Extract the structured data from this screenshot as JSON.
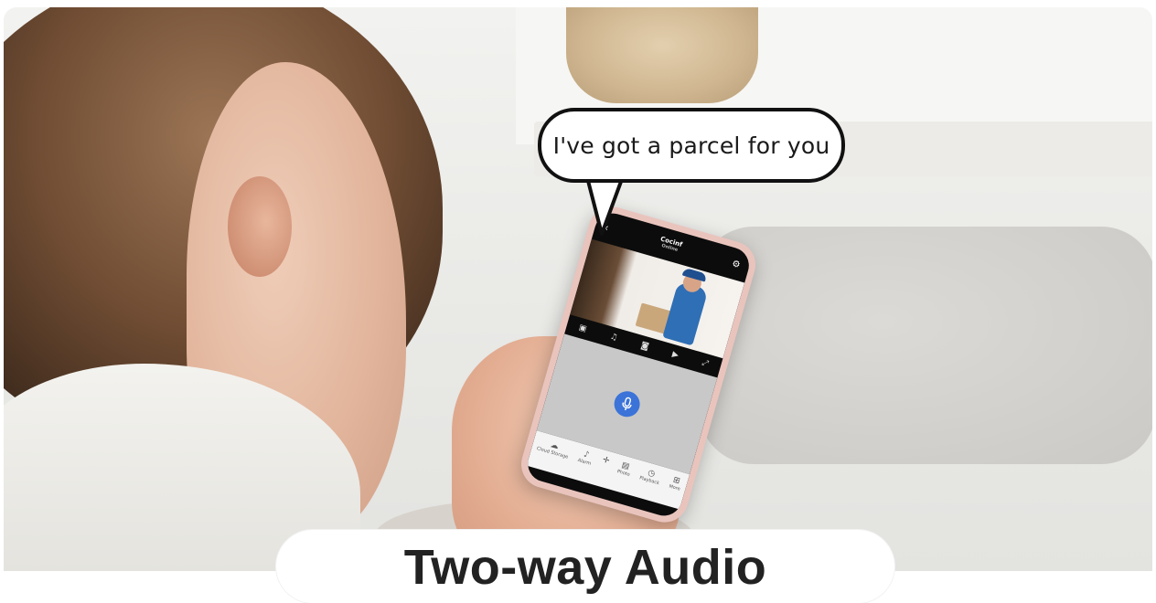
{
  "speech_bubble": {
    "text": "I've got a parcel for you"
  },
  "caption": {
    "title": "Two-way Audio"
  },
  "phone_app": {
    "header": {
      "title": "Cocinf",
      "subtitle": "Online",
      "back_icon": "back-arrow-icon",
      "settings_icon": "gear-icon"
    },
    "controls": [
      "record-icon",
      "speaker-icon",
      "snapshot-icon",
      "video-record-icon",
      "fullscreen-icon"
    ],
    "talk_button_icon": "microphone-icon",
    "nav_items": [
      {
        "label": "Cloud Storage",
        "icon": "cloud-icon"
      },
      {
        "label": "Alarm",
        "icon": "bell-icon"
      },
      {
        "label": "",
        "icon": "joystick-icon"
      },
      {
        "label": "Photo",
        "icon": "photo-icon"
      },
      {
        "label": "Playback",
        "icon": "playback-icon"
      },
      {
        "label": "More",
        "icon": "grid-icon"
      }
    ]
  },
  "colors": {
    "mic_button": "#3b73d8",
    "phone_case": "#e9c4bd",
    "bubble_border": "#111111"
  }
}
